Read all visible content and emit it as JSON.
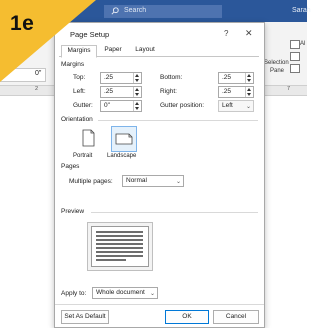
{
  "badge": {
    "text": "1e",
    "color": "#f5bd30"
  },
  "background": {
    "search_placeholder": "Search",
    "user_name": "Sarah",
    "left_field_value": "0\"",
    "ruler_left": "2",
    "ruler_right": "7",
    "ribbon_right": {
      "selection_label": "Selection",
      "pane_label": "Pane",
      "al_label": "Al"
    },
    "accent": "#2b579a"
  },
  "dialog": {
    "title": "Page Setup",
    "help": "?",
    "close": "✕",
    "tabs": [
      "Margins",
      "Paper",
      "Layout"
    ],
    "active_tab": "Margins",
    "margins_heading": "Margins",
    "top": {
      "label": "Top:",
      "value": ".25"
    },
    "bottom": {
      "label": "Bottom:",
      "value": ".25"
    },
    "left": {
      "label": "Left:",
      "value": ".25"
    },
    "right": {
      "label": "Right:",
      "value": ".25"
    },
    "gutter": {
      "label": "Gutter:",
      "value": "0\""
    },
    "gutter_position": {
      "label": "Gutter position:",
      "value": "Left"
    },
    "orientation_heading": "Orientation",
    "portrait_label": "Portrait",
    "landscape_label": "Landscape",
    "selected_orientation": "Landscape",
    "pages_heading": "Pages",
    "multiple_pages": {
      "label": "Multiple pages:",
      "value": "Normal"
    },
    "preview_heading": "Preview",
    "apply_to": {
      "label": "Apply to:",
      "value": "Whole document"
    },
    "set_default_label": "Set As Default",
    "ok_label": "OK",
    "cancel_label": "Cancel"
  }
}
